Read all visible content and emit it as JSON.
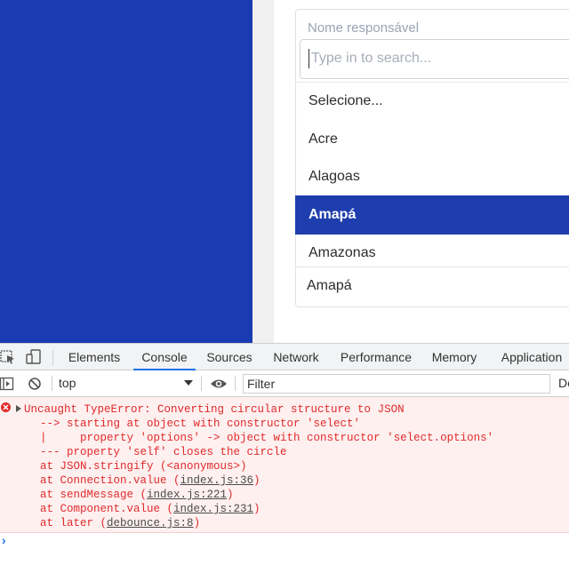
{
  "colors": {
    "brand_blue": "#1b3bb3",
    "selected_option_bg": "#1f3ead",
    "error_red": "#e02a2a"
  },
  "form": {
    "field_label": "Nome responsável",
    "search_placeholder": "Type in to search...",
    "options": [
      "Selecione...",
      "Acre",
      "Alagoas",
      "Amapá",
      "Amazonas"
    ],
    "selected_index": 3,
    "selected_value": "Amapá"
  },
  "devtools": {
    "tabs": [
      "Elements",
      "Console",
      "Sources",
      "Network",
      "Performance",
      "Memory",
      "Application"
    ],
    "active_tab": "Console",
    "context": "top",
    "filter_placeholder": "Filter",
    "levels_label": "De",
    "error": {
      "line1": "Uncaught TypeError: Converting circular structure to JSON",
      "line2": "    --> starting at object with constructor 'select'",
      "line3": "    |     property 'options' -> object with constructor 'select.options'",
      "line4": "    --- property 'self' closes the circle",
      "stack": [
        {
          "prefix": "    at JSON.stringify (",
          "link": "",
          "suffix": "<anonymous>)"
        },
        {
          "prefix": "    at Connection.value (",
          "link": "index.js:36",
          "suffix": ")"
        },
        {
          "prefix": "    at sendMessage (",
          "link": "index.js:221",
          "suffix": ")"
        },
        {
          "prefix": "    at Component.value (",
          "link": "index.js:231",
          "suffix": ")"
        },
        {
          "prefix": "    at later (",
          "link": "debounce.js:8",
          "suffix": ")"
        }
      ]
    },
    "prompt": "›"
  }
}
